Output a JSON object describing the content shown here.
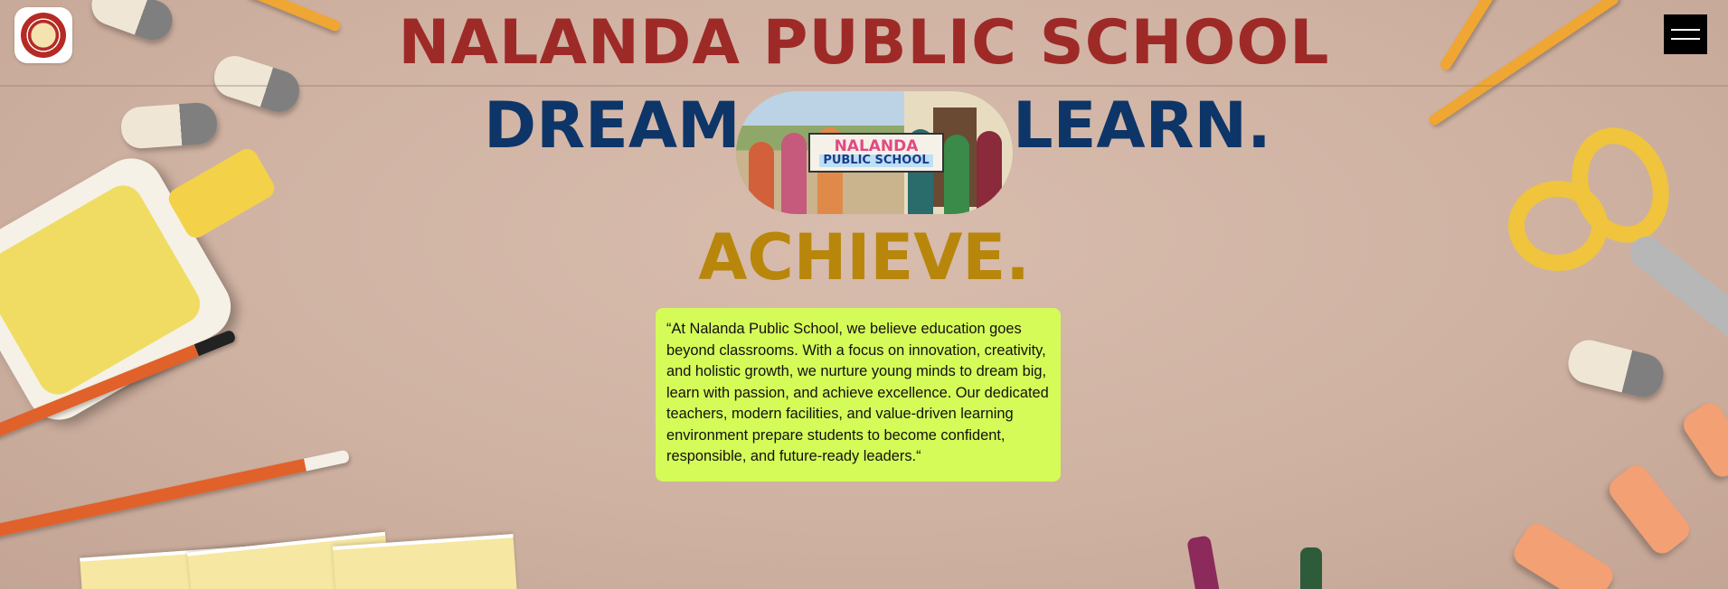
{
  "header": {
    "logo_label": "Nalanda Public School logo",
    "menu_icon": "hamburger-menu-icon"
  },
  "hero": {
    "school_name": "NALANDA PUBLIC SCHOOL",
    "tag_dream": "DREAM.",
    "tag_learn": "LEARN.",
    "tag_achieve": "ACHIEVE.",
    "photo_banner_line1": "NALANDA",
    "photo_banner_line2": "PUBLIC SCHOOL"
  },
  "quote": {
    "text": "“At Nalanda Public School, we believe education goes beyond classrooms. With a focus on innovation, creativity, and holistic growth, we nurture young minds to dream big, learn with passion, and achieve excellence. Our dedicated teachers, modern facilities, and value-driven learning environment prepare students to become confident, responsible, and future-ready leaders.“"
  },
  "colors": {
    "school_name": "#9e2a28",
    "tagline_blue": "#0d3568",
    "tagline_gold": "#b8860b",
    "quote_bg": "#d5fb58",
    "background": "#cdb1a3"
  }
}
